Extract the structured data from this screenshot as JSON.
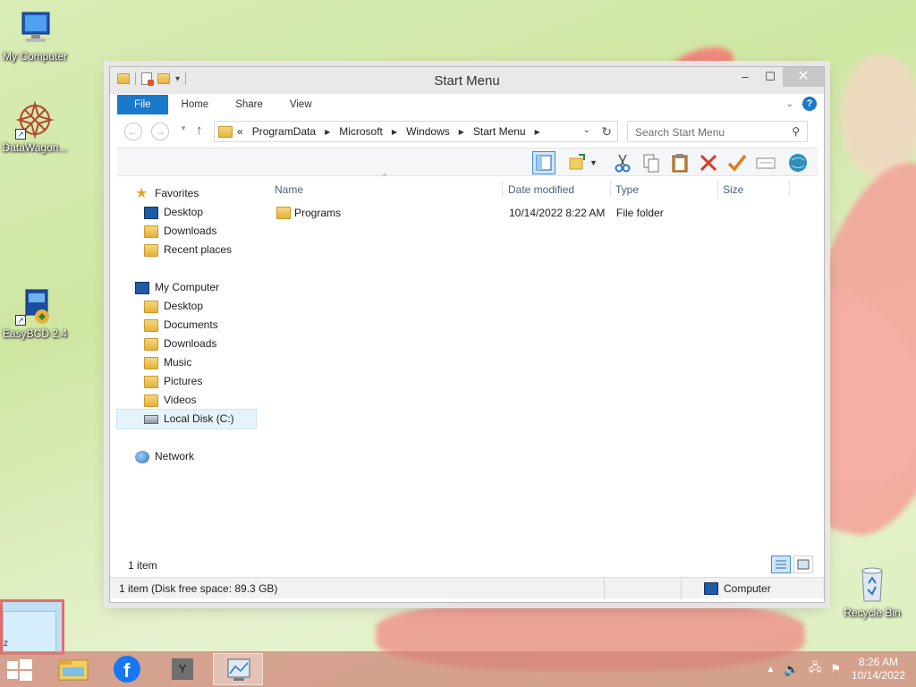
{
  "desktop": {
    "icons": [
      {
        "label": "My Computer"
      },
      {
        "label": "DataWagon..."
      },
      {
        "label": "EasyBCD 2.4"
      },
      {
        "label": "Recycle Bin"
      }
    ],
    "side_window_text": "z"
  },
  "window": {
    "title": "Start Menu",
    "ribbon_tabs": [
      "File",
      "Home",
      "Share",
      "View"
    ],
    "help_label": "?",
    "address": {
      "prefix": "«",
      "crumbs": [
        "ProgramData",
        "Microsoft",
        "Windows",
        "Start Menu"
      ]
    },
    "search": {
      "placeholder": "Search Start Menu"
    },
    "nav": {
      "favorites": "Favorites",
      "fav_items": [
        "Desktop",
        "Downloads",
        "Recent places"
      ],
      "computer": "My Computer",
      "computer_items": [
        "Desktop",
        "Documents",
        "Downloads",
        "Music",
        "Pictures",
        "Videos",
        "Local Disk (C:)"
      ],
      "network": "Network"
    },
    "columns": [
      "Name",
      "Date modified",
      "Type",
      "Size"
    ],
    "rows": [
      {
        "name": "Programs",
        "date": "10/14/2022 8:22 AM",
        "type": "File folder",
        "size": ""
      }
    ],
    "item_count": "1 item",
    "status_left": "1 item (Disk free space: 89.3 GB)",
    "status_right": "Computer"
  },
  "taskbar": {
    "time": "8:26 AM",
    "date": "10/14/2022",
    "y_app_label": "Y"
  },
  "colors": {
    "accent": "#1979ca",
    "taskbar": "#d0827a"
  }
}
